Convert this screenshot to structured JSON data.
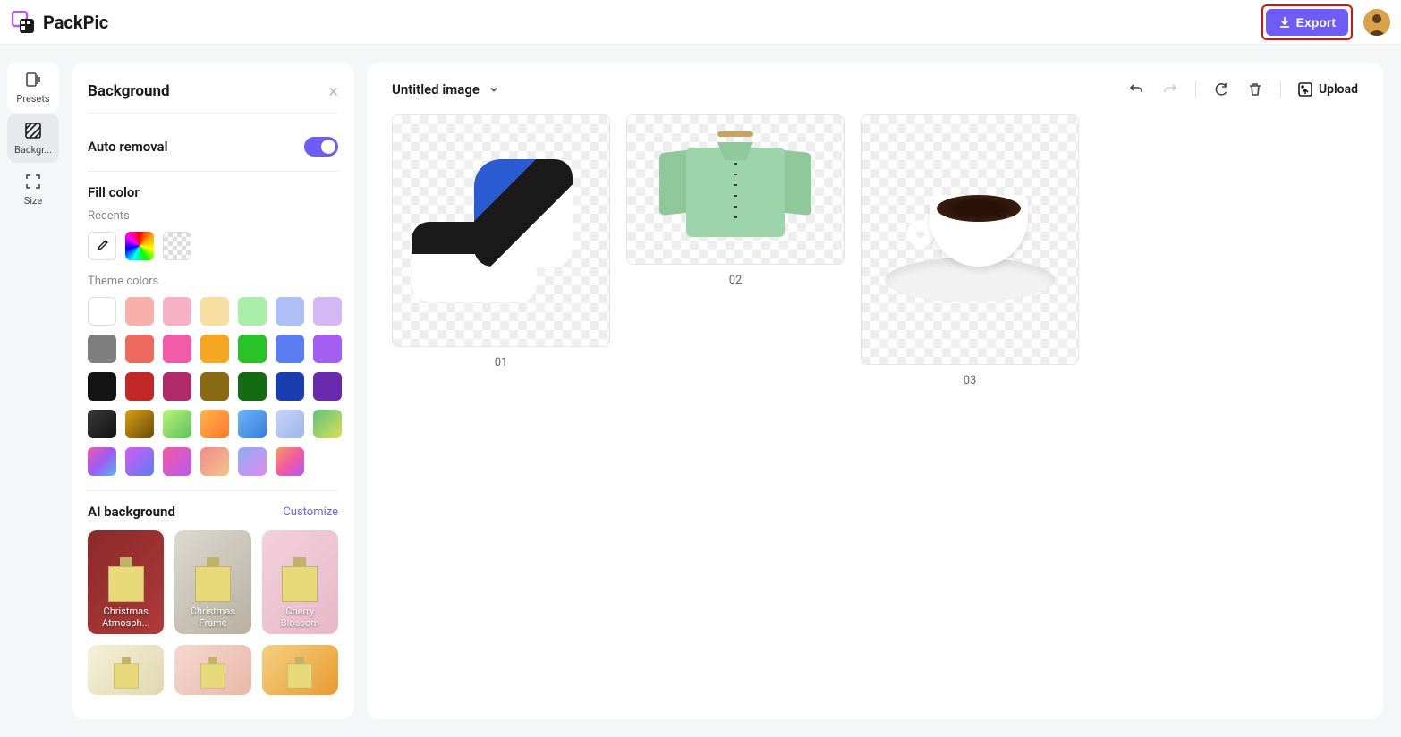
{
  "header": {
    "app_name": "PackPic",
    "export_label": "Export"
  },
  "rail": {
    "presets": "Presets",
    "background": "Backgr...",
    "size": "Size"
  },
  "panel": {
    "title": "Background",
    "auto_removal": "Auto removal",
    "fill_color": "Fill color",
    "recents": "Recents",
    "theme_colors": "Theme colors",
    "theme_swatches": [
      "#ffffff",
      "#f8b0ab",
      "#f8b0c5",
      "#f6dea0",
      "#a9eea9",
      "#aebff5",
      "#d3b8f5",
      "#7f7f7f",
      "#ef6a5e",
      "#f25ba8",
      "#f5a623",
      "#29c229",
      "#5a7ef2",
      "#a45ef2",
      "#141414",
      "#c22828",
      "#b02a6a",
      "#8a6a14",
      "#146b14",
      "#1a3db0",
      "#6a2ab0",
      "linear-gradient(135deg,#3a3a3a,#111)",
      "linear-gradient(135deg,#d9a014,#6a4a08)",
      "linear-gradient(135deg,#b9f27a,#5ec25e)",
      "linear-gradient(135deg,#ffb347,#ff7730)",
      "linear-gradient(135deg,#6ab7f5,#3a7ae0)",
      "linear-gradient(135deg,#c6d4f5,#9eb5ee)",
      "",
      "linear-gradient(135deg,#5ec27a,#d9e05a)",
      "linear-gradient(135deg,#f25ba8,#9e5af2,#5ab7f2)",
      "linear-gradient(135deg,#d85af2,#5a7ef2)",
      "linear-gradient(135deg,#f25a9e,#b85af2)",
      "linear-gradient(135deg,#f28a8a,#f2c48a)",
      "linear-gradient(135deg,#8aaef2,#e08af2)",
      "linear-gradient(135deg,#f2a05a,#f25a9e,#b85af2)"
    ],
    "ai_background": "AI background",
    "customize": "Customize",
    "ai_items": [
      {
        "label": "Christmas Atmosph...",
        "bg": "linear-gradient(135deg,#8a2a2a,#b03a3a)"
      },
      {
        "label": "Christmas Frame",
        "bg": "linear-gradient(135deg,#dcd9d0,#b8b0a0)"
      },
      {
        "label": "Cherry Blossom",
        "bg": "linear-gradient(135deg,#f2d0dc,#e8b8c8)"
      }
    ],
    "ai_items_small": [
      {
        "bg": "linear-gradient(135deg,#f5f0d8,#e0d8b0)"
      },
      {
        "bg": "linear-gradient(135deg,#f5d8d0,#e8b8a8)"
      },
      {
        "bg": "linear-gradient(135deg,#f5d080,#e89a30)"
      }
    ]
  },
  "canvas": {
    "title": "Untitled image",
    "upload": "Upload",
    "thumbs": [
      "01",
      "02",
      "03"
    ]
  }
}
